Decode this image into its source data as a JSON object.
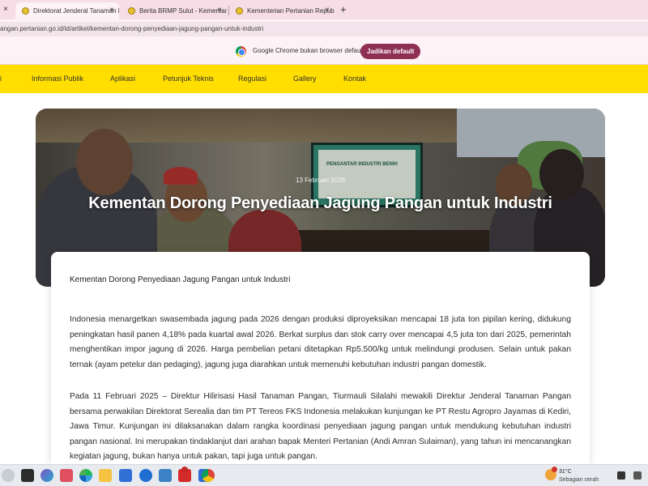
{
  "browser": {
    "tabs": [
      {
        "label": "Direktorat Jenderal Tanaman Pangan",
        "active": true
      },
      {
        "label": "Berita BRMP Sulut - Kementan",
        "active": false
      },
      {
        "label": "Kementerian Pertanian Republik",
        "active": false
      }
    ],
    "close_glyph": "×",
    "new_tab_glyph": "+",
    "address": "angan.pertanian.go.id/id/artikel/kementan-dorong-penyediaan-jagung-pangan-untuk-industri"
  },
  "infobar": {
    "message": "Google Chrome bukan browser default",
    "button_label": "Jadikan default"
  },
  "site_nav": {
    "items": [
      "i",
      "Informasi Publik",
      "Aplikasi",
      "Petunjuk Teknis",
      "Regulasi",
      "Gallery",
      "Kontak"
    ]
  },
  "hero": {
    "date": "13 Februari 2026",
    "title": "Kementan Dorong Penyediaan Jagung Pangan untuk Industri",
    "screen_text": "PENGANTAR INDUSTRI BENIH"
  },
  "article": {
    "title": "Kementan Dorong Penyediaan Jagung Pangan untuk Industri",
    "paragraphs": [
      "Indonesia menargetkan swasembada jagung pada 2026 dengan produksi diproyeksikan mencapai 18 juta ton pipilan kering, didukung peningkatan hasil panen 4,18% pada kuartal awal 2026. Berkat surplus dan stok carry over mencapai 4,5 juta ton dari 2025, pemerintah menghentikan impor jagung di 2026. Harga pembelian petani ditetapkan Rp5.500/kg untuk melindungi produsen. Selain untuk pakan ternak (ayam petelur dan pedaging), jagung juga diarahkan untuk memenuhi kebutuhan industri pangan domestik.",
      "Pada 11 Februari 2025 – Direktur Hilirisasi Hasil Tanaman Pangan, Tiurmauli Silalahi mewakili Direktur Jenderal Tanaman Pangan bersama perwakilan Direktorat Serealia dan tim PT Tereos FKS Indonesia melakukan kunjungan ke PT Restu Agropro Jayamas di Kediri, Jawa Timur. Kunjungan ini dilaksanakan dalam rangka koordinasi penyediaan jagung pangan untuk mendukung kebutuhan industri pangan nasional. Ini merupakan tindaklanjut dari arahan bapak Menteri Pertanian (Andi Amran Sulaiman), yang tahun ini mencanangkan kegiatan jagung, bukan hanya untuk pakan, tapi juga untuk pangan."
    ]
  },
  "taskbar": {
    "weather_temp": "31°C",
    "weather_desc": "Sebagian cerah"
  },
  "colors": {
    "nav_bg": "#ffde00",
    "infobar_button": "#8e2f53",
    "tabstrip_bg": "#f6dde6"
  }
}
